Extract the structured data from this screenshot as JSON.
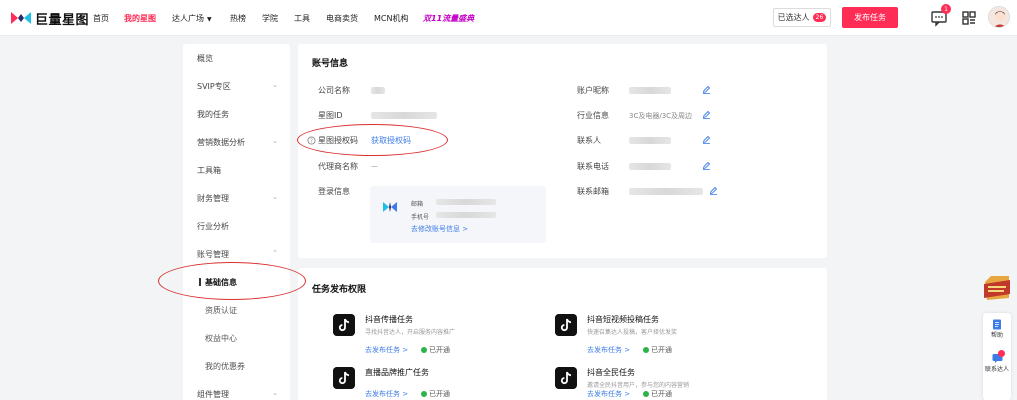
{
  "nav": {
    "logo_text": "巨量星图",
    "items": [
      {
        "label": "首页"
      },
      {
        "label": "我的星图"
      },
      {
        "label": "达人广场"
      },
      {
        "label": "热榜"
      },
      {
        "label": "学院"
      },
      {
        "label": "工具"
      },
      {
        "label": "电商卖货"
      },
      {
        "label": "MCN机构"
      },
      {
        "label": "双11流量盛典"
      }
    ],
    "selected_label": "已选达人",
    "selected_count": "26",
    "publish_label": "发布任务",
    "message_count": "1"
  },
  "sidebar": {
    "items": [
      {
        "label": "概览"
      },
      {
        "label": "SVIP专区"
      },
      {
        "label": "我的任务"
      },
      {
        "label": "营销数据分析"
      },
      {
        "label": "工具箱"
      },
      {
        "label": "财务管理"
      },
      {
        "label": "行业分析"
      },
      {
        "label": "账号管理"
      },
      {
        "label": "基础信息"
      },
      {
        "label": "资质认证"
      },
      {
        "label": "权益中心"
      },
      {
        "label": "我的优惠券"
      },
      {
        "label": "组件管理"
      }
    ]
  },
  "account": {
    "title": "账号信息",
    "company_label": "公司名称",
    "star_id_label": "星图ID",
    "auth_code_label": "星图授权码",
    "auth_code_link": "获取授权码",
    "agent_label": "代理商名称",
    "agent_value": "—",
    "login_label": "登录信息",
    "login_email_label": "邮箱",
    "login_phone_label": "手机号",
    "login_edit_link": "去修改账号信息 >",
    "nickname_label": "账户昵称",
    "industry_label": "行业信息",
    "industry_value": "3C及电器/3C及周边",
    "contact_label": "联系人",
    "phone_label": "联系电话",
    "email_label": "联系邮箱"
  },
  "tasks": {
    "title": "任务发布权限",
    "items": [
      {
        "name": "抖音传播任务",
        "desc": "寻找抖音达人，开启服务内容推广",
        "link": "去发布任务 >",
        "status": "已开通"
      },
      {
        "name": "抖音短视频投稿任务",
        "desc": "快速召集达人投稿，客户择优发奖",
        "link": "去发布任务 >",
        "status": "已开通"
      },
      {
        "name": "直播品牌推广任务",
        "desc": "",
        "link": "去发布任务 >",
        "status": "已开通"
      },
      {
        "name": "抖音全民任务",
        "desc": "邀请全民抖音用户，参与您的内容营销",
        "link": "去发布任务 >",
        "status": "已开通"
      }
    ]
  },
  "floating": {
    "help_label": "帮助",
    "contact_label": "联系达人"
  },
  "colors": {
    "brand": "#ff2c55",
    "link": "#3d7ce8",
    "annotation": "#d9302f",
    "enabled": "#2cb34a"
  }
}
